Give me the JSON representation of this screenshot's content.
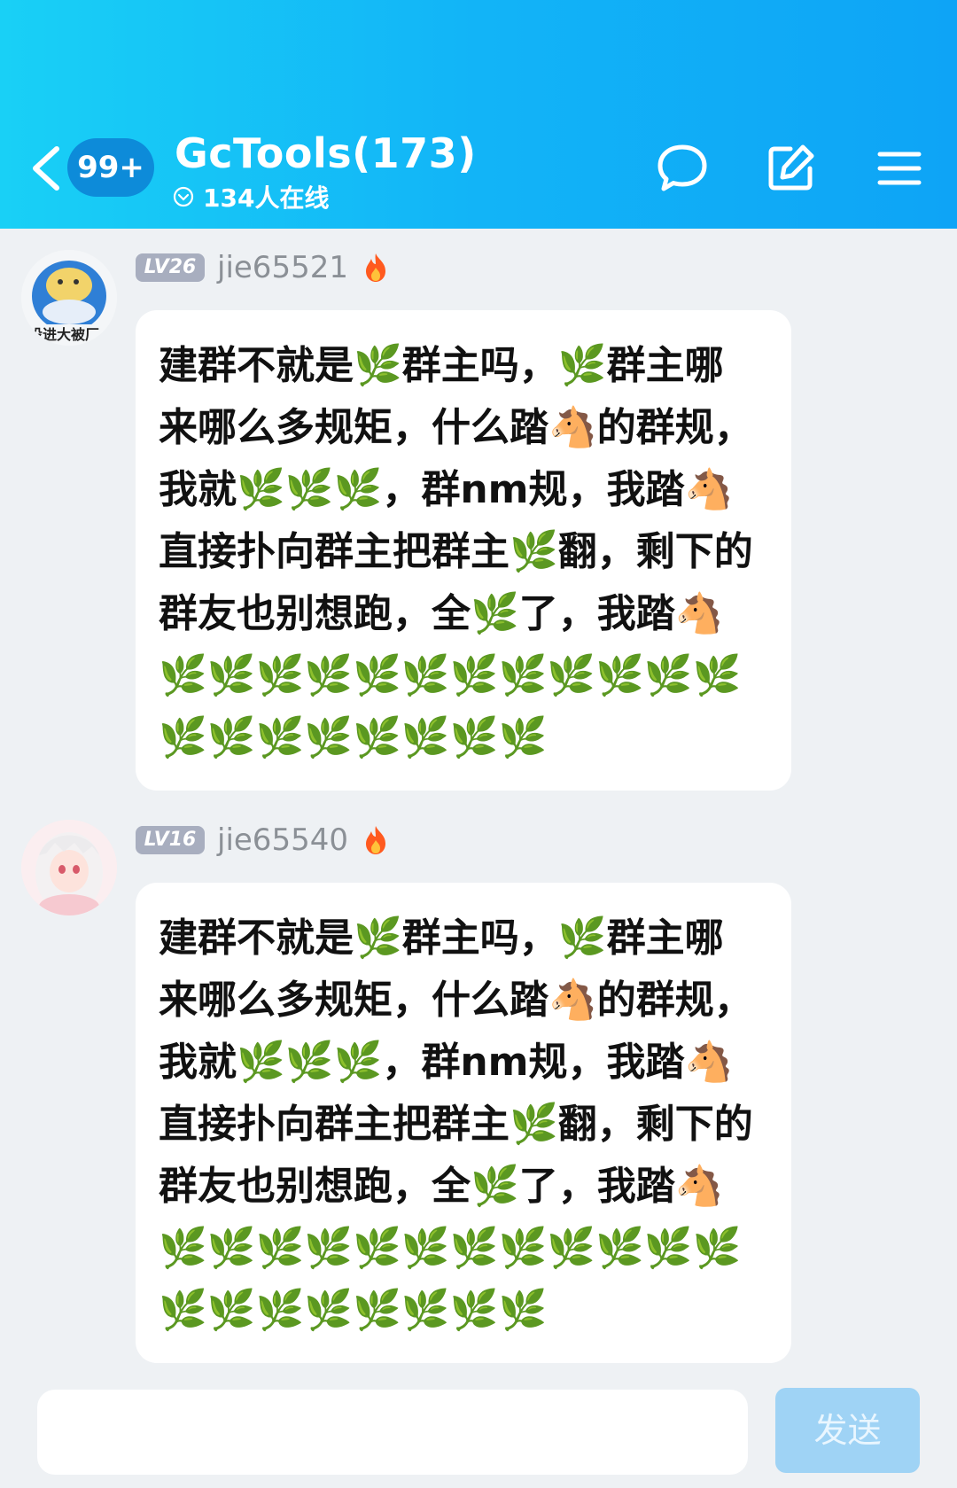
{
  "header": {
    "unread_badge": "99+",
    "group_title": "GcTools(173)",
    "online_text": "134人在线"
  },
  "messages": [
    {
      "level": "LV26",
      "username": "jie65521",
      "avatar_caption": "设进大被厂",
      "text": "建群不就是🌿群主吗，🌿群主哪来哪么多规矩，什么踏🐴的群规，我就🌿🌿🌿，群nm规，我踏🐴直接扑向群主把群主🌿翻，剩下的群友也别想跑，全🌿了，我踏🐴🌿🌿🌿🌿🌿🌿🌿🌿🌿🌿🌿🌿🌿🌿🌿🌿🌿🌿🌿🌿"
    },
    {
      "level": "LV16",
      "username": "jie65540",
      "text": "建群不就是🌿群主吗，🌿群主哪来哪么多规矩，什么踏🐴的群规，我就🌿🌿🌿，群nm规，我踏🐴直接扑向群主把群主🌿翻，剩下的群友也别想跑，全🌿了，我踏🐴🌿🌿🌿🌿🌿🌿🌿🌿🌿🌿🌿🌿🌿🌿🌿🌿🌿🌿🌿🌿"
    }
  ],
  "input": {
    "placeholder": "",
    "send_label": "发送"
  },
  "colors": {
    "header_start": "#19d0f6",
    "header_end": "#0ea4f6",
    "send_button": "#9fd3f5",
    "level_badge": "#a8aebf"
  }
}
